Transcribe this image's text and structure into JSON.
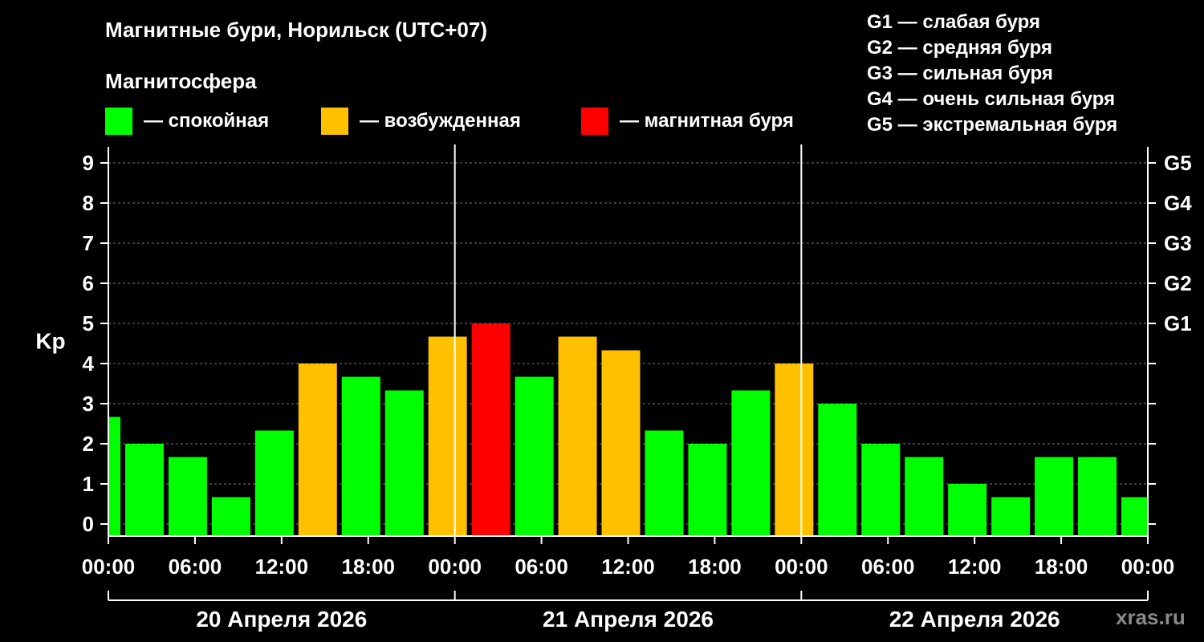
{
  "title": "Магнитные бури, Норильск (UTC+07)",
  "subtitle": "Магнитосфера",
  "legend": [
    {
      "label": "— спокойная",
      "color": "#00ff00"
    },
    {
      "label": "— возбужденная",
      "color": "#ffc000"
    },
    {
      "label": "— магнитная буря",
      "color": "#ff0000"
    }
  ],
  "storm_levels": [
    "G1 — слабая буря",
    "G2 — средняя буря",
    "G3 — сильная буря",
    "G4 — очень сильная буря",
    "G5 — экстремальная буря"
  ],
  "watermark": "xras.ru",
  "colors": {
    "quiet": "#00ff00",
    "excited": "#ffc000",
    "storm": "#ff0000"
  },
  "chart_data": {
    "type": "bar",
    "ylabel": "Kp",
    "ylim": [
      -0.3,
      9.4
    ],
    "yticks": [
      0,
      1,
      2,
      3,
      4,
      5,
      6,
      7,
      8,
      9
    ],
    "right_axis": [
      {
        "value": 5,
        "label": "G1"
      },
      {
        "value": 6,
        "label": "G2"
      },
      {
        "value": 7,
        "label": "G3"
      },
      {
        "value": 8,
        "label": "G4"
      },
      {
        "value": 9,
        "label": "G5"
      }
    ],
    "xlim": [
      0,
      72
    ],
    "xticks": [
      {
        "value": 0,
        "label": "00:00"
      },
      {
        "value": 6,
        "label": "06:00"
      },
      {
        "value": 12,
        "label": "12:00"
      },
      {
        "value": 18,
        "label": "18:00"
      },
      {
        "value": 24,
        "label": "00:00"
      },
      {
        "value": 30,
        "label": "06:00"
      },
      {
        "value": 36,
        "label": "12:00"
      },
      {
        "value": 42,
        "label": "18:00"
      },
      {
        "value": 48,
        "label": "00:00"
      },
      {
        "value": 54,
        "label": "06:00"
      },
      {
        "value": 60,
        "label": "12:00"
      },
      {
        "value": 66,
        "label": "18:00"
      },
      {
        "value": 72,
        "label": "00:00"
      }
    ],
    "days": [
      {
        "label": "20 Апреля 2026",
        "start": 0,
        "end": 24
      },
      {
        "label": "21 Апреля 2026",
        "start": 24,
        "end": 48
      },
      {
        "label": "22 Апреля 2026",
        "start": 48,
        "end": 72
      }
    ],
    "day_separators": [
      24,
      48
    ],
    "grid": true,
    "bars": [
      {
        "start": 0,
        "end": 1,
        "value": 2.67,
        "level": "quiet"
      },
      {
        "start": 1,
        "end": 4,
        "value": 2.0,
        "level": "quiet"
      },
      {
        "start": 4,
        "end": 7,
        "value": 1.67,
        "level": "quiet"
      },
      {
        "start": 7,
        "end": 10,
        "value": 0.67,
        "level": "quiet"
      },
      {
        "start": 10,
        "end": 13,
        "value": 2.33,
        "level": "quiet"
      },
      {
        "start": 13,
        "end": 16,
        "value": 4.0,
        "level": "excited"
      },
      {
        "start": 16,
        "end": 19,
        "value": 3.67,
        "level": "quiet"
      },
      {
        "start": 19,
        "end": 22,
        "value": 3.33,
        "level": "quiet"
      },
      {
        "start": 22,
        "end": 25,
        "value": 4.67,
        "level": "excited"
      },
      {
        "start": 25,
        "end": 28,
        "value": 5.0,
        "level": "storm"
      },
      {
        "start": 28,
        "end": 31,
        "value": 3.67,
        "level": "quiet"
      },
      {
        "start": 31,
        "end": 34,
        "value": 4.67,
        "level": "excited"
      },
      {
        "start": 34,
        "end": 37,
        "value": 4.33,
        "level": "excited"
      },
      {
        "start": 37,
        "end": 40,
        "value": 2.33,
        "level": "quiet"
      },
      {
        "start": 40,
        "end": 43,
        "value": 2.0,
        "level": "quiet"
      },
      {
        "start": 43,
        "end": 46,
        "value": 3.33,
        "level": "quiet"
      },
      {
        "start": 46,
        "end": 49,
        "value": 4.0,
        "level": "excited"
      },
      {
        "start": 49,
        "end": 52,
        "value": 3.0,
        "level": "quiet"
      },
      {
        "start": 52,
        "end": 55,
        "value": 2.0,
        "level": "quiet"
      },
      {
        "start": 55,
        "end": 58,
        "value": 1.67,
        "level": "quiet"
      },
      {
        "start": 58,
        "end": 61,
        "value": 1.0,
        "level": "quiet"
      },
      {
        "start": 61,
        "end": 64,
        "value": 0.67,
        "level": "quiet"
      },
      {
        "start": 64,
        "end": 67,
        "value": 1.67,
        "level": "quiet"
      },
      {
        "start": 67,
        "end": 70,
        "value": 1.67,
        "level": "quiet"
      },
      {
        "start": 70,
        "end": 72,
        "value": 0.67,
        "level": "quiet"
      }
    ]
  }
}
